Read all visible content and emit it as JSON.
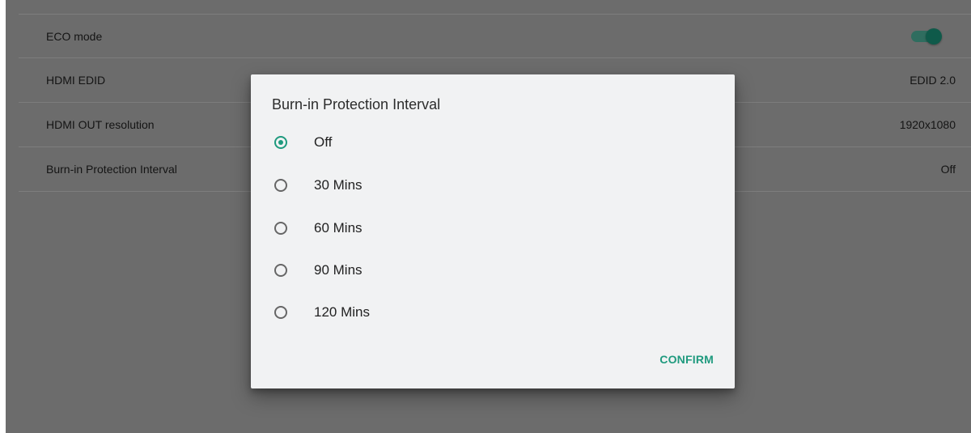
{
  "settings": {
    "rows": [
      {
        "label": "ECO mode",
        "toggle_on": true
      },
      {
        "label": "HDMI EDID",
        "value": "EDID 2.0"
      },
      {
        "label": "HDMI OUT resolution",
        "value": "1920x1080"
      },
      {
        "label": "Burn-in Protection Interval",
        "value": "Off"
      }
    ]
  },
  "dialog": {
    "title": "Burn-in Protection Interval",
    "options": [
      {
        "label": "Off",
        "selected": true
      },
      {
        "label": "30 Mins",
        "selected": false
      },
      {
        "label": "60 Mins",
        "selected": false
      },
      {
        "label": "90 Mins",
        "selected": false
      },
      {
        "label": "120 Mins",
        "selected": false
      }
    ],
    "confirm_label": "CONFIRM"
  },
  "colors": {
    "accent": "#1f9a7e",
    "scrim_background": "#6c6c6c",
    "dialog_background": "#f1f2f3"
  },
  "icons": {
    "radio_checked": "radio-checked-icon",
    "radio_unchecked": "radio-unchecked-icon",
    "toggle": "toggle-switch-icon"
  }
}
